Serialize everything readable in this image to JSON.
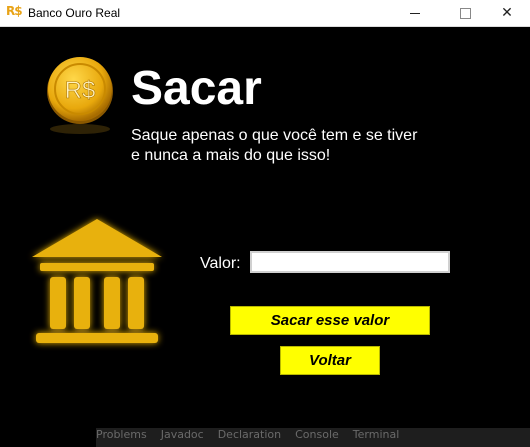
{
  "window": {
    "icon_text": "R$",
    "title": "Banco Ouro Real",
    "minimize_glyph": "",
    "maximize_glyph": "",
    "close_glyph": "✕"
  },
  "header": {
    "coin_icon": "coin-icon",
    "coin_text": "R$",
    "title": "Sacar",
    "subtitle_line1": "Saque apenas o que você tem e se tiver",
    "subtitle_line2": "e nunca a mais do que isso!"
  },
  "form": {
    "bank_icon": "bank-building-icon",
    "valor_label": "Valor:",
    "valor_value": "",
    "submit_label": "Sacar esse valor",
    "back_label": "Voltar"
  },
  "colors": {
    "background": "#000000",
    "button": "#ffff00",
    "gold": "#e8b10e"
  }
}
